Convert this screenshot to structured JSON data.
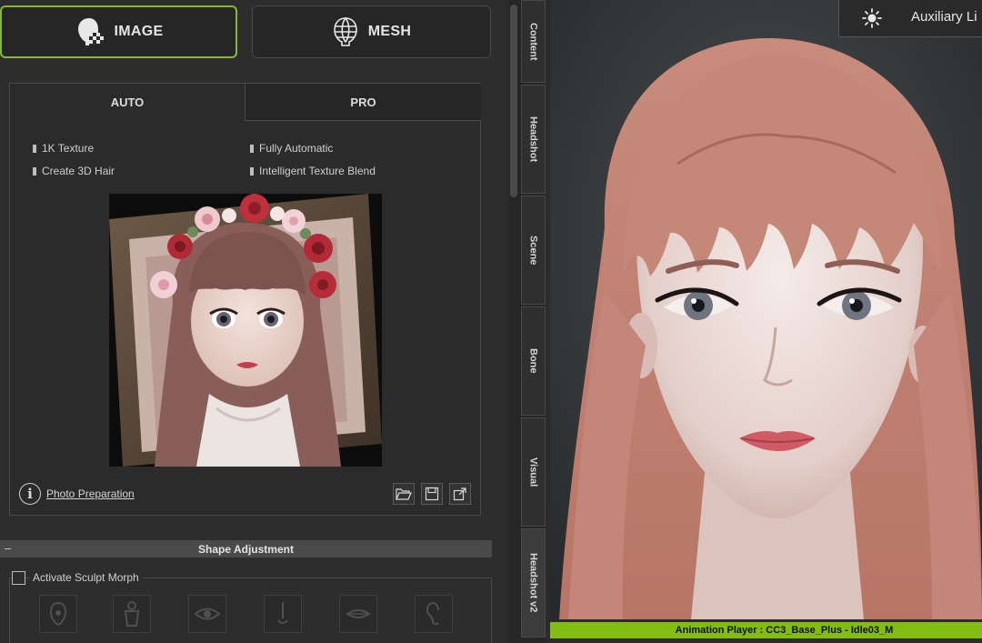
{
  "mode_buttons": {
    "image": "IMAGE",
    "mesh": "MESH"
  },
  "tabs": {
    "auto": "AUTO",
    "pro": "PRO"
  },
  "features": [
    "1K Texture",
    "Fully Automatic",
    "Create 3D Hair",
    "Intelligent Texture Blend"
  ],
  "photo_preparation": "Photo Preparation",
  "info_icon": "i",
  "tool_icons": [
    "folder-open-icon",
    "save-icon",
    "export-icon"
  ],
  "shape_adjustment": {
    "title": "Shape Adjustment",
    "collapse_symbol": "–"
  },
  "sculpt": {
    "label": "Activate Sculpt Morph",
    "checked": false
  },
  "sculpt_parts": [
    "head-part-icon",
    "body-part-icon",
    "eye-part-icon",
    "nose-part-icon",
    "mouth-part-icon",
    "ear-part-icon"
  ],
  "vertical_tabs": [
    "Content",
    "Headshot",
    "Scene",
    "Bone",
    "Visual",
    "Headshot v2"
  ],
  "aux_light": {
    "label": "Auxiliary Li"
  },
  "animation_player": "Animation Player : CC3_Base_Plus - Idle03_M",
  "colors": {
    "accent": "#86b73a",
    "status_bar": "#83bc12",
    "panel": "#2d2d2d"
  }
}
